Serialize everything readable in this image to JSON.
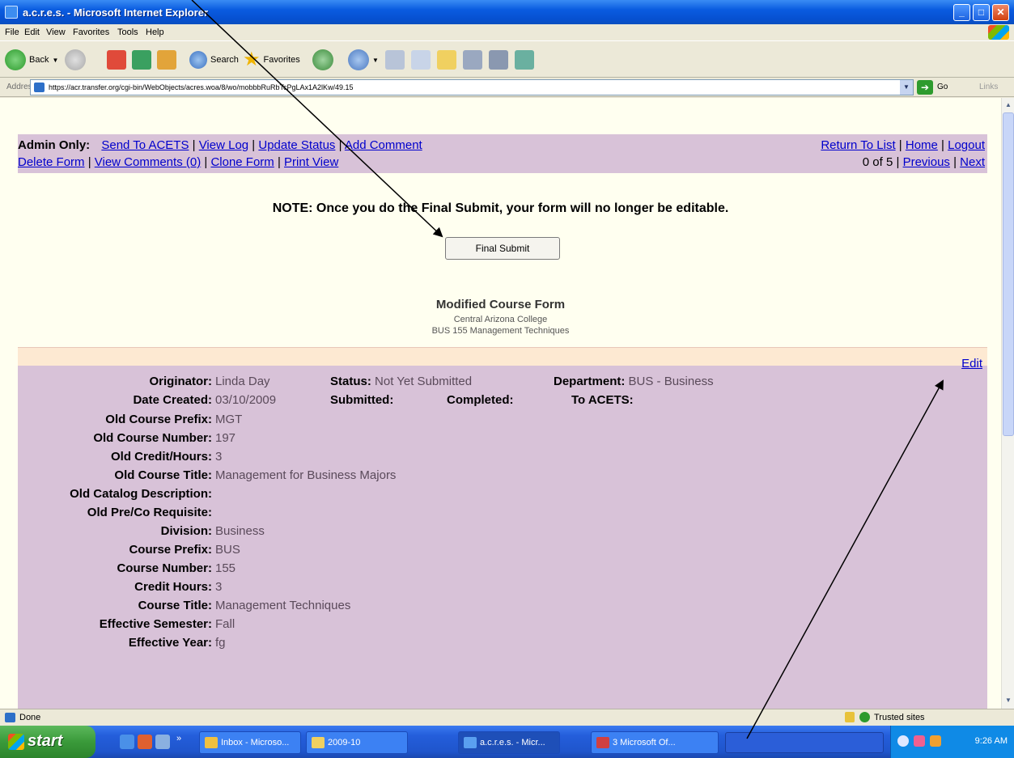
{
  "window": {
    "title": "a.c.r.e.s. - Microsoft Internet Explorer",
    "minimize": "_",
    "maximize": "□",
    "close": "✕"
  },
  "menu": [
    "File",
    "Edit",
    "View",
    "Favorites",
    "Tools",
    "Help"
  ],
  "toolbar": {
    "back_label": "Back",
    "search_label": "Search",
    "favorites_label": "Favorites"
  },
  "address": {
    "label": "Address",
    "url": "https://acr.transfer.org/cgi-bin/WebObjects/acres.woa/8/wo/mobbbRuRbTcPgLAx1A2lKw/49.15",
    "go_label": "Go",
    "links_label": "Links"
  },
  "admin": {
    "label": "Admin Only:",
    "row1_left": [
      "Send To ACETS",
      "View Log",
      "Update Status",
      "Add Comment"
    ],
    "row1_right": [
      "Return To List",
      "Home",
      "Logout"
    ],
    "row2_left": [
      "Delete Form",
      "View Comments (0)",
      "Clone Form",
      "Print View"
    ],
    "pager_count": "0 of 5",
    "pager_prev": "Previous",
    "pager_next": "Next"
  },
  "note": "NOTE: Once you do the Final Submit, your form will no longer be editable.",
  "final_submit_label": "Final Submit",
  "form": {
    "title": "Modified Course Form",
    "college": "Central Arizona College",
    "course": "BUS 155 Management Techniques",
    "edit_label": "Edit"
  },
  "header_fields": {
    "originator_label": "Originator:",
    "originator_value": "Linda Day",
    "status_label": "Status:",
    "status_value": "Not Yet Submitted",
    "department_label": "Department:",
    "department_value": "BUS - Business",
    "date_created_label": "Date Created:",
    "date_created_value": "03/10/2009",
    "submitted_label": "Submitted:",
    "completed_label": "Completed:",
    "to_acets_label": "To ACETS:"
  },
  "fields": [
    {
      "label": "Old Course Prefix:",
      "value": "MGT"
    },
    {
      "label": "Old Course Number:",
      "value": "197"
    },
    {
      "label": "Old Credit/Hours:",
      "value": "3"
    },
    {
      "label": "Old Course Title:",
      "value": "Management for Business Majors"
    },
    {
      "label": "Old Catalog Description:",
      "value": ""
    },
    {
      "label": "Old Pre/Co Requisite:",
      "value": ""
    },
    {
      "label": "Division:",
      "value": "Business"
    },
    {
      "label": "Course Prefix:",
      "value": "BUS"
    },
    {
      "label": "Course Number:",
      "value": "155"
    },
    {
      "label": "Credit Hours:",
      "value": "3"
    },
    {
      "label": "Course Title:",
      "value": "Management Techniques"
    },
    {
      "label": "Effective Semester:",
      "value": "Fall"
    },
    {
      "label": "Effective Year:",
      "value": "fg"
    }
  ],
  "status_bar": {
    "left": "Done",
    "zone": "Trusted sites"
  },
  "taskbar": {
    "start_label": "start",
    "tasks": [
      "Inbox - Microso...",
      "2009-10",
      "a.c.r.e.s. - Micr...",
      "3 Microsoft Of..."
    ],
    "clock": "9:26 AM"
  },
  "colors": {
    "panel_purple": "#d8c2d8",
    "page_bg": "#fffff0",
    "link_blue": "#0000cc",
    "edit_strip": "#fde9d2"
  }
}
